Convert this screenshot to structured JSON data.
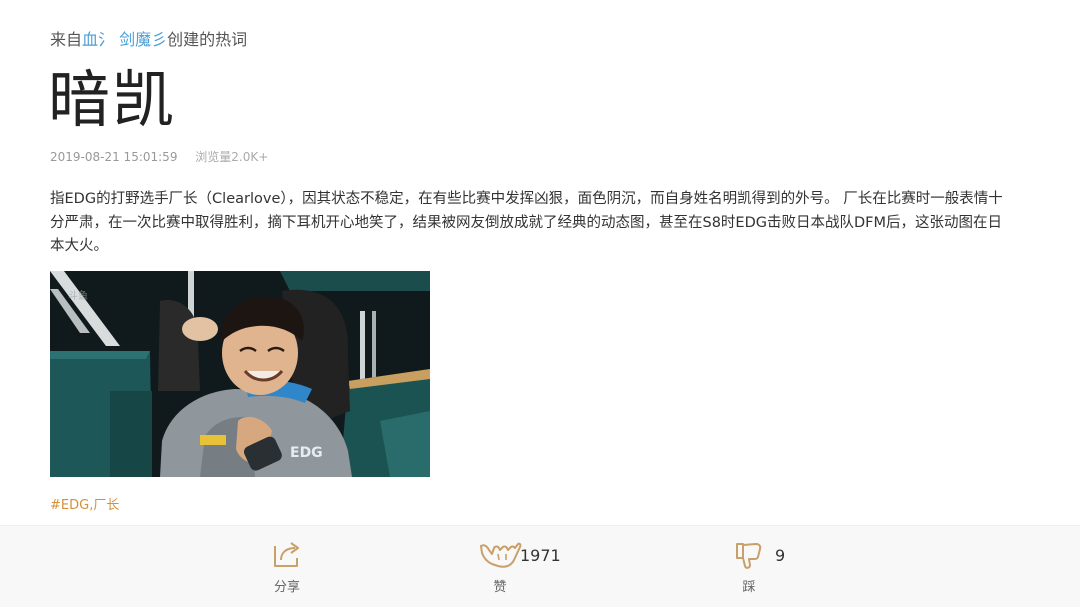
{
  "source": {
    "prefix": "来自",
    "author": "血氵 剑魔彡",
    "suffix": "创建的热词"
  },
  "title": "暗凯",
  "meta": {
    "datetime": "2019-08-21 15:01:59",
    "views": "浏览量2.0K+"
  },
  "body": "指EDG的打野选手厂长（Clearlove），因其状态不稳定，在有些比赛中发挥凶狠，面色阴沉，而自身姓名明凯得到的外号。 厂长在比赛时一般表情十分严肃，在一次比赛中取得胜利，摘下耳机开心地笑了，结果被网友倒放成就了经典的动态图，甚至在S8时EDG击败日本战队DFM后，这张动图在日本大火。",
  "image": {
    "jersey_text": "EDG",
    "colors": {
      "background": "#10191c",
      "teal": "#1f5a5a",
      "hoodie": "#8f969c",
      "accent_blue": "#2f86c8",
      "chair": "#222222"
    }
  },
  "tags": "#EDG,厂长",
  "actions": {
    "share_label": "分享",
    "like_label": "赞",
    "like_count": "1971",
    "dislike_label": "踩",
    "dislike_count": "9"
  },
  "colors": {
    "author_link": "#4a9fd6",
    "tag": "#d4903a",
    "icon": "#c9a06a",
    "action_bar_bg": "#f8f8f8"
  },
  "icons": {
    "share": "share-icon",
    "like": "shaka-hand-icon",
    "dislike": "thumbs-down-icon"
  }
}
